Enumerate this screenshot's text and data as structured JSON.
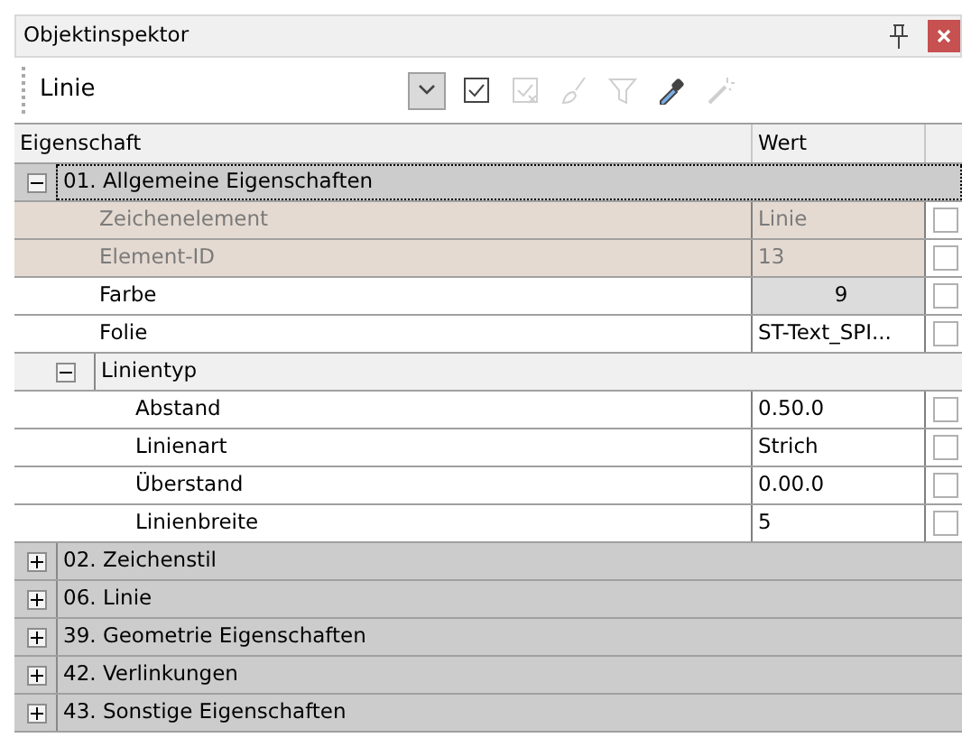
{
  "window": {
    "title": "Objektinspektor"
  },
  "toolbar": {
    "object_name": "Linie",
    "buttons": [
      {
        "kind": "dropdown",
        "pressed": true,
        "disabled": false
      },
      {
        "kind": "check",
        "disabled": false
      },
      {
        "kind": "check-cross",
        "disabled": true
      },
      {
        "kind": "brush",
        "disabled": true
      },
      {
        "kind": "filter",
        "disabled": true
      },
      {
        "kind": "eyedropper",
        "disabled": false
      },
      {
        "kind": "wand",
        "disabled": true
      }
    ]
  },
  "table": {
    "columns": [
      "Eigenschaft",
      "Wert"
    ],
    "groups": [
      {
        "label": "01. Allgemeine Eigenschaften",
        "expanded": true,
        "selected": true,
        "children": [
          {
            "kind": "property",
            "label": "Zeichenelement",
            "value": "Linie",
            "readonly": true,
            "checked": false
          },
          {
            "kind": "property",
            "label": "Element-ID",
            "value": "13",
            "readonly": true,
            "checked": false
          },
          {
            "kind": "color",
            "label": "Farbe",
            "value": "9",
            "readonly": false,
            "checked": false
          },
          {
            "kind": "property",
            "label": "Folie",
            "value": "ST-Text_SPI...",
            "readonly": false,
            "checked": false
          },
          {
            "kind": "subgroup",
            "label": "Linientyp",
            "expanded": true,
            "children": [
              {
                "kind": "property",
                "label": "Abstand",
                "value": "0.50.0",
                "readonly": false,
                "checked": false
              },
              {
                "kind": "property",
                "label": "Linienart",
                "value": "Strich",
                "readonly": false,
                "checked": false
              },
              {
                "kind": "property",
                "label": "Überstand",
                "value": "0.00.0",
                "readonly": false,
                "checked": false
              },
              {
                "kind": "property",
                "label": "Linienbreite",
                "value": "5",
                "readonly": false,
                "checked": false
              }
            ]
          }
        ]
      },
      {
        "label": "02. Zeichenstil",
        "expanded": false,
        "selected": false
      },
      {
        "label": "06. Linie",
        "expanded": false,
        "selected": false
      },
      {
        "label": "39. Geometrie Eigenschaften",
        "expanded": false,
        "selected": false
      },
      {
        "label": "42. Verlinkungen",
        "expanded": false,
        "selected": false
      },
      {
        "label": "43. Sonstige Eigenschaften",
        "expanded": false,
        "selected": false
      }
    ]
  }
}
